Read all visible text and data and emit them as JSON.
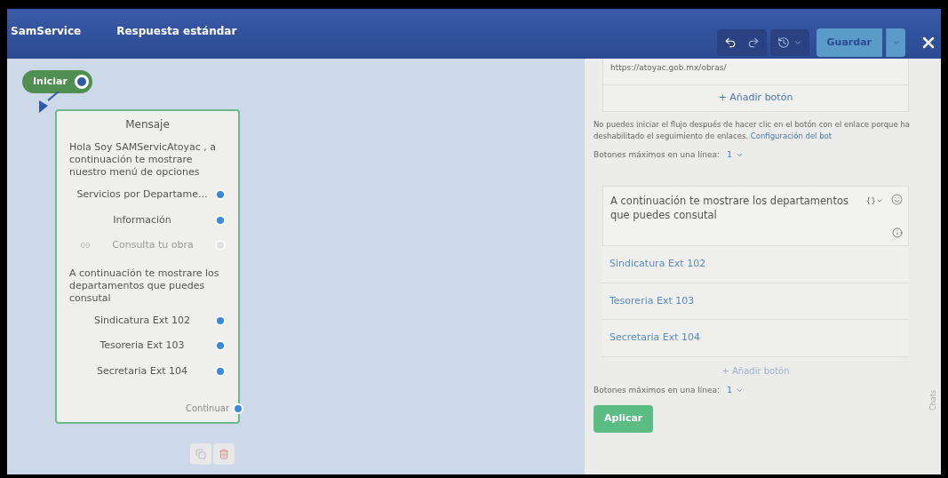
{
  "header": {
    "brand": "SamService",
    "title": "Respuesta estándar",
    "save": "Guardar"
  },
  "canvas": {
    "start": "Iniciar",
    "node": {
      "title": "Mensaje",
      "blocks": [
        {
          "text": "Hola Soy SAMServicAtoyac  , a continuación te mostrare nuestro menú de opciones",
          "buttons": [
            {
              "label": "Servicios por Departame...",
              "kind": "reply"
            },
            {
              "label": "Información",
              "kind": "reply"
            },
            {
              "label": "Consulta tu obra",
              "kind": "link"
            }
          ]
        },
        {
          "text": "A continuación te mostrare los departamentos que puedes consutal",
          "buttons": [
            {
              "label": "Sindicatura Ext 102",
              "kind": "reply"
            },
            {
              "label": "Tesoreria Ext 103",
              "kind": "reply"
            },
            {
              "label": "Secretaria Ext 104",
              "kind": "reply"
            }
          ]
        }
      ],
      "continue": "Continuar"
    }
  },
  "panel": {
    "url": "https://atoyac.gob.mx/obras/",
    "add_button_1": "+ Añadir botón",
    "notice": "No puedes iniciar el flujo después de hacer clic en el botón con el enlace porque ha deshabilitado el seguimiento de enlaces.",
    "notice_link": "Configuración del bot",
    "max_label_1": "Botones máximos en una línea:",
    "max_value_1": "1",
    "message": "A continuación te mostrare los departamentos que puedes consutal",
    "variable_button": "{}",
    "buttons": [
      "Sindicatura Ext 102",
      "Tesoreria Ext 103",
      "Secretaria Ext 104"
    ],
    "add_button_2": "+ Añadir botón",
    "max_label_2": "Botones máximos en una línea:",
    "max_value_2": "1",
    "apply": "Aplicar",
    "side_tab": "Chats"
  }
}
